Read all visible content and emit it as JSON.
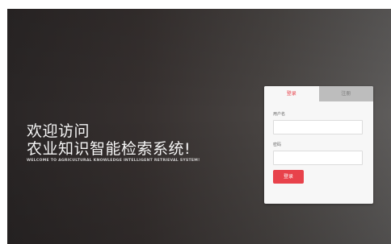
{
  "hero": {
    "line1": "欢迎访问",
    "line2": "农业知识智能检索系统!",
    "subtitle": "WELCOME TO AGRICULTURAL KNOWLEDGE INTELLIGENT RETRIEVAL SYSTEM!"
  },
  "login_card": {
    "tabs": [
      {
        "label": "登录",
        "active": true
      },
      {
        "label": "注册",
        "active": false
      }
    ],
    "username_label": "用户名",
    "username_value": "",
    "password_label": "密码",
    "password_value": "",
    "submit_label": "登录"
  },
  "colors": {
    "accent": "#e8424b",
    "inactive_tab": "#bdbdbd",
    "card_background": "#f7f7f7"
  }
}
